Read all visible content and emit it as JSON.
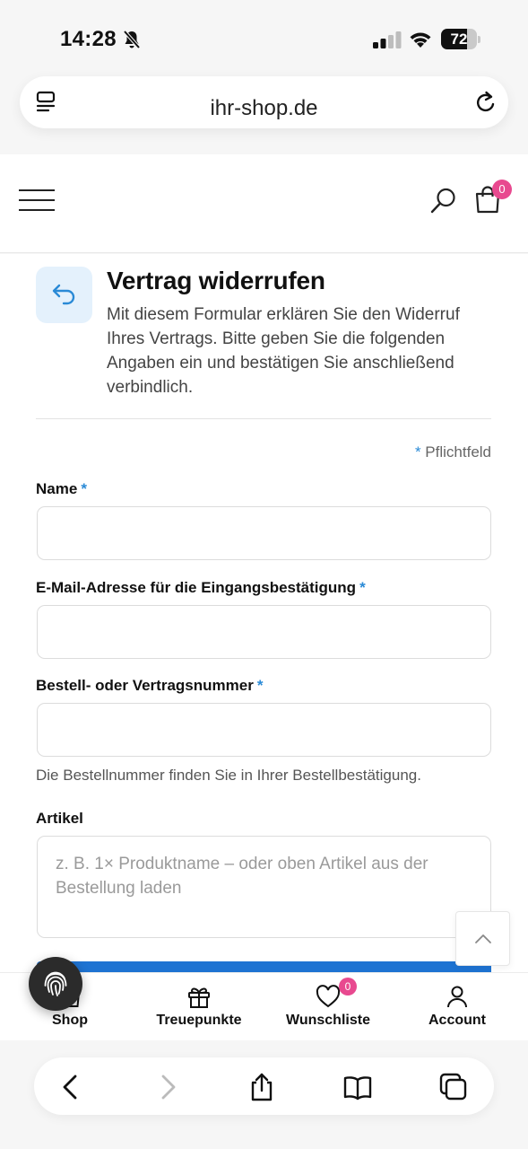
{
  "status_bar": {
    "time": "14:28",
    "battery": "72",
    "battery_level": 0.72,
    "icons": [
      "bell-slash-icon",
      "signal-icon",
      "wifi-icon",
      "battery-icon"
    ]
  },
  "browser": {
    "url": "ihr-shop.de"
  },
  "header": {
    "cart_count": "0",
    "icons": [
      "menu-icon",
      "search-icon",
      "shopping-bag-icon"
    ]
  },
  "form": {
    "title": "Vertrag widerrufen",
    "intro": "Mit diesem Formular erklären Sie den Widerruf Ihres Vertrags. Bitte geben Sie die folgenden Angaben ein und bestätigen Sie anschließend verbindlich.",
    "required_star": "*",
    "required_note": "Pflichtfeld",
    "fields": [
      {
        "label": "Name",
        "required": true,
        "value": ""
      },
      {
        "label": "E-Mail-Adresse für die Eingangsbestätigung",
        "required": true,
        "value": ""
      },
      {
        "label": "Bestell- oder Vertragsnummer",
        "required": true,
        "value": "",
        "help": "Die Bestellnummer finden Sie in Ihrer Bestellbestätigung."
      },
      {
        "label": "Artikel",
        "required": false,
        "placeholder": "z. B. 1× Produktname – oder oben Artikel aus der Bestellung laden"
      }
    ]
  },
  "bottom_nav": {
    "items": [
      {
        "label": "Shop",
        "icon": "shop-icon"
      },
      {
        "label": "Treuepunkte",
        "icon": "gift-icon"
      },
      {
        "label": "Wunschliste",
        "icon": "heart-icon",
        "badge": "0"
      },
      {
        "label": "Account",
        "icon": "user-icon"
      }
    ]
  },
  "colors": {
    "accent": "#1e73d2",
    "badge": "#e8498f",
    "required_star": "#2a8ad6"
  }
}
